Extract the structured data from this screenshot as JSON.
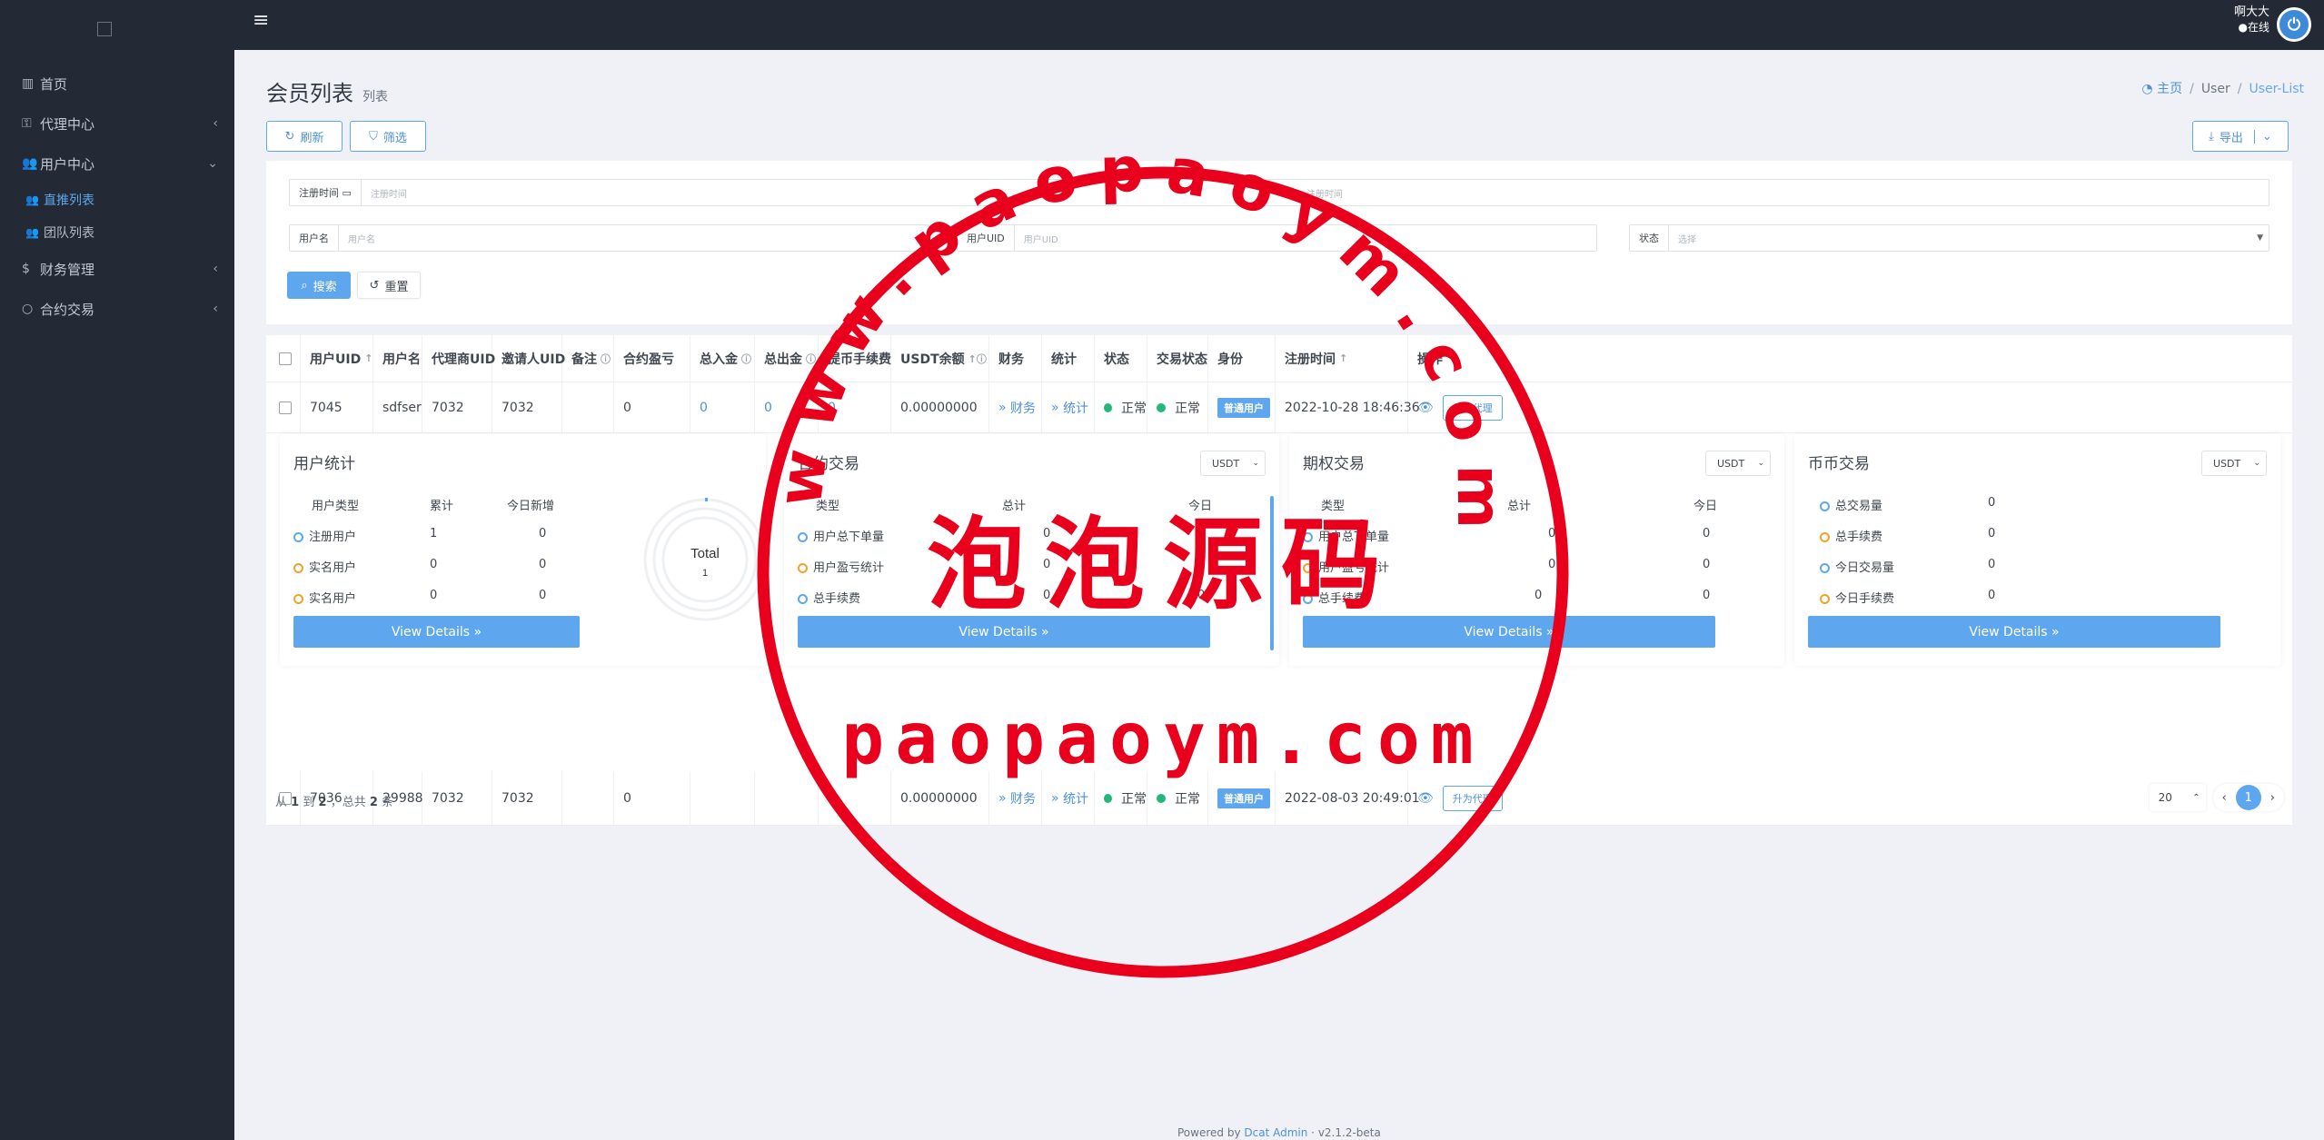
{
  "sidebar": {
    "items": [
      {
        "label": "首页",
        "icon": "bar-chart-icon"
      },
      {
        "label": "代理中心",
        "icon": "lock-icon"
      },
      {
        "label": "用户中心",
        "icon": "users-icon"
      },
      {
        "label": "直推列表",
        "icon": "users-icon"
      },
      {
        "label": "团队列表",
        "icon": "users-icon"
      },
      {
        "label": "财务管理",
        "icon": "dollar-icon"
      },
      {
        "label": "合约交易",
        "icon": "circle-icon"
      }
    ]
  },
  "topbar": {
    "user_name": "啊大大",
    "status": "在线"
  },
  "page": {
    "title": "会员列表",
    "subtitle": "列表"
  },
  "breadcrumb": {
    "home": "主页",
    "level1": "User",
    "level2": "User-List"
  },
  "toolbar": {
    "refresh": "刷新",
    "filter": "筛选",
    "export": "导出"
  },
  "filters": {
    "reg_time_label": "注册时间",
    "reg_time_placeholder": "注册时间",
    "reg_time_end_placeholder": "注册时间",
    "username_label": "用户名",
    "username_placeholder": "用户名",
    "uid_label": "用户UID",
    "uid_placeholder": "用户UID",
    "status_label": "状态",
    "status_placeholder": "选择",
    "search": "搜索",
    "reset": "重置"
  },
  "table": {
    "headers": [
      "用户UID",
      "用户名",
      "代理商UID",
      "邀请人UID",
      "备注",
      "合约盈亏",
      "总入金",
      "总出金",
      "提币手续费",
      "USDT余额",
      "财务",
      "统计",
      "状态",
      "交易状态",
      "身份",
      "注册时间",
      "操作"
    ],
    "rows": [
      {
        "uid": "7045",
        "username": "sdfser",
        "agent_uid": "7032",
        "inviter_uid": "7032",
        "remark": "",
        "pnl": "0",
        "deposit": "0",
        "withdraw": "0",
        "fee": "0",
        "usdt": "0.00000000",
        "finance": "财务",
        "stats": "统计",
        "status": "正常",
        "trade_status": "正常",
        "role": "普通用户",
        "reg_time": "2022-10-28 18:46:36",
        "action": "升为代理"
      },
      {
        "uid": "7036",
        "username": "29988",
        "agent_uid": "7032",
        "inviter_uid": "7032",
        "remark": "",
        "pnl": "0",
        "deposit": "",
        "withdraw": "",
        "fee": "",
        "usdt": "0.00000000",
        "finance": "财务",
        "stats": "统计",
        "status": "正常",
        "trade_status": "正常",
        "role": "普通用户",
        "reg_time": "2022-08-03 20:49:01",
        "action": "升为代理"
      }
    ]
  },
  "cards": {
    "user_stats": {
      "title": "用户统计",
      "cols": [
        "用户类型",
        "累计",
        "今日新增"
      ],
      "rows": [
        [
          "注册用户",
          "1",
          "0"
        ],
        [
          "实名用户",
          "0",
          "0"
        ],
        [
          "实名用户",
          "0",
          "0"
        ]
      ],
      "donut_label": "Total",
      "donut_value": "1",
      "details": "View Details"
    },
    "contract": {
      "title": "合约交易",
      "select": "USDT",
      "cols": [
        "类型",
        "总计",
        "今日"
      ],
      "rows": [
        [
          "用户总下单量",
          "0",
          "0"
        ],
        [
          "用户盈亏统计",
          "0",
          "0"
        ],
        [
          "总手续费",
          "0",
          "0"
        ]
      ],
      "details": "View Details"
    },
    "option": {
      "title": "期权交易",
      "select": "USDT",
      "cols": [
        "类型",
        "总计",
        "今日"
      ],
      "rows": [
        [
          "用户总下单量",
          "0",
          "0"
        ],
        [
          "用户盈亏统计",
          "0",
          "0"
        ],
        [
          "总手续费",
          "0",
          "0"
        ]
      ],
      "details": "View Details"
    },
    "coin": {
      "title": "币币交易",
      "select": "USDT",
      "rows": [
        [
          "总交易量",
          "0"
        ],
        [
          "总手续费",
          "0"
        ],
        [
          "今日交易量",
          "0"
        ],
        [
          "今日手续费",
          "0"
        ]
      ],
      "details": "View Details"
    }
  },
  "footer": {
    "prefix": "从",
    "from": "1",
    "mid": "到",
    "to": "2",
    "sep": "，总共",
    "total": "2",
    "suffix": "条"
  },
  "pagination": {
    "per_page": "20",
    "current": "1"
  },
  "powered": {
    "prefix": "Powered by",
    "link": "Dcat Admin",
    "version": "v2.1.2-beta"
  },
  "watermark": {
    "arc_text": "www.paopaoym.com",
    "cn_text": "泡泡源码",
    "bottom_text": "paopaoym.com",
    "color": "#e8001c"
  },
  "colors": {
    "sidebar": "#232a35",
    "accent": "#5ea7ee",
    "success": "#21b978",
    "watermark": "#e8001c"
  }
}
